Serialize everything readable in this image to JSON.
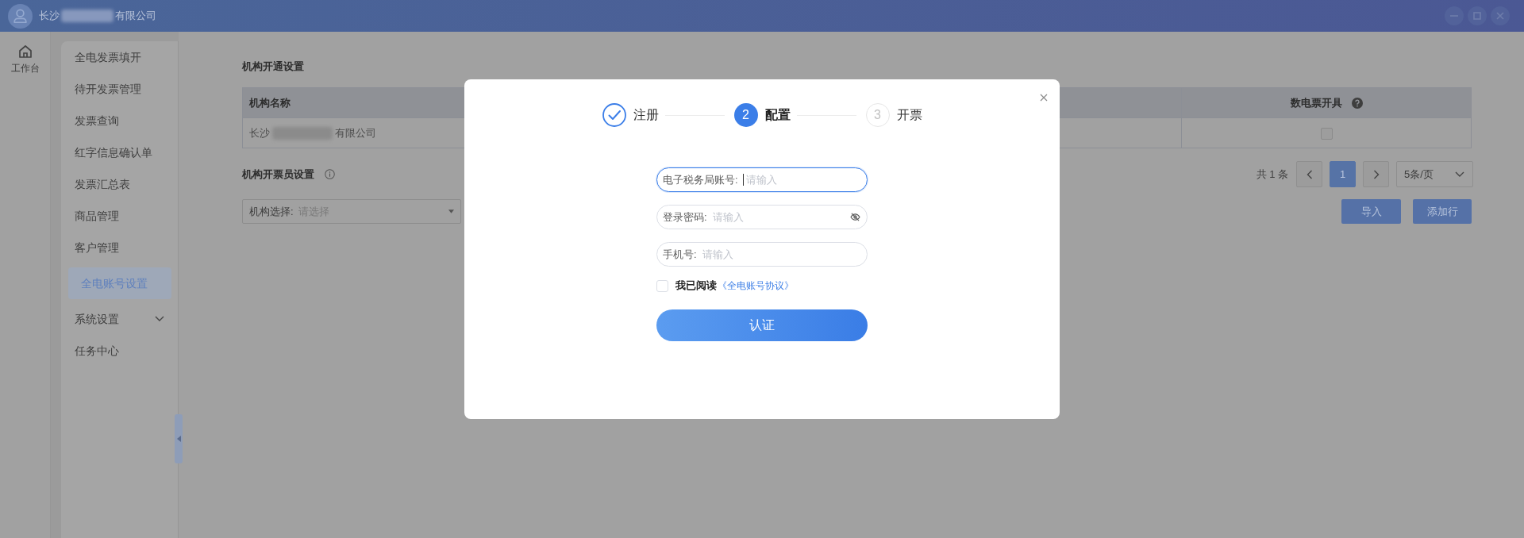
{
  "header": {
    "company_prefix": "长沙",
    "company_suffix": "有限公司"
  },
  "rail": {
    "items": [
      {
        "label": "工作台"
      }
    ]
  },
  "sidebar": {
    "items": [
      {
        "label": "全电发票填开",
        "kind": "link",
        "selected": false
      },
      {
        "label": "待开发票管理",
        "kind": "link",
        "selected": false
      },
      {
        "label": "发票查询",
        "kind": "link",
        "selected": false
      },
      {
        "label": "红字信息确认单",
        "kind": "link",
        "selected": false
      },
      {
        "label": "发票汇总表",
        "kind": "link",
        "selected": false
      },
      {
        "label": "商品管理",
        "kind": "link",
        "selected": false
      },
      {
        "label": "客户管理",
        "kind": "link",
        "selected": false
      },
      {
        "label": "全电账号设置",
        "kind": "link",
        "selected": true
      },
      {
        "label": "系统设置",
        "kind": "submenu",
        "selected": false,
        "expanded": false
      },
      {
        "label": "任务中心",
        "kind": "link",
        "selected": false
      }
    ]
  },
  "org_setup": {
    "title": "机构开通设置",
    "columns": [
      {
        "label": "机构名称"
      },
      {
        "label": "数电票开具"
      }
    ],
    "rows": [
      {
        "name_prefix": "长沙",
        "name_suffix": "有限公司",
        "digital_invoice": false
      }
    ],
    "pagination": {
      "total": "共 1 条",
      "pages": [
        {
          "label": "1",
          "selected": true
        }
      ],
      "page_size": "5条/页"
    }
  },
  "issuer_setup": {
    "title": "机构开票员设置",
    "org_select": {
      "label": "机构选择:",
      "placeholder": "请选择"
    },
    "buttons": [
      "导入",
      "添加行"
    ]
  },
  "dialog": {
    "steps": [
      {
        "label": "注册",
        "completed": true,
        "selected": false
      },
      {
        "number": "2",
        "label": "配置",
        "completed": false,
        "selected": true
      },
      {
        "number": "3",
        "label": "开票",
        "completed": false,
        "selected": false
      }
    ],
    "fields": [
      {
        "kind": "text",
        "label": "电子税务局账号:",
        "placeholder": "请输入",
        "focused": true
      },
      {
        "kind": "password",
        "label": "登录密码:",
        "placeholder": "请输入",
        "focused": false
      },
      {
        "kind": "text",
        "label": "手机号:",
        "placeholder": "请输入",
        "focused": false
      }
    ],
    "agreement": {
      "checked": false,
      "text": "我已阅读",
      "link": "《全电账号协议》"
    },
    "submit": "认证"
  }
}
